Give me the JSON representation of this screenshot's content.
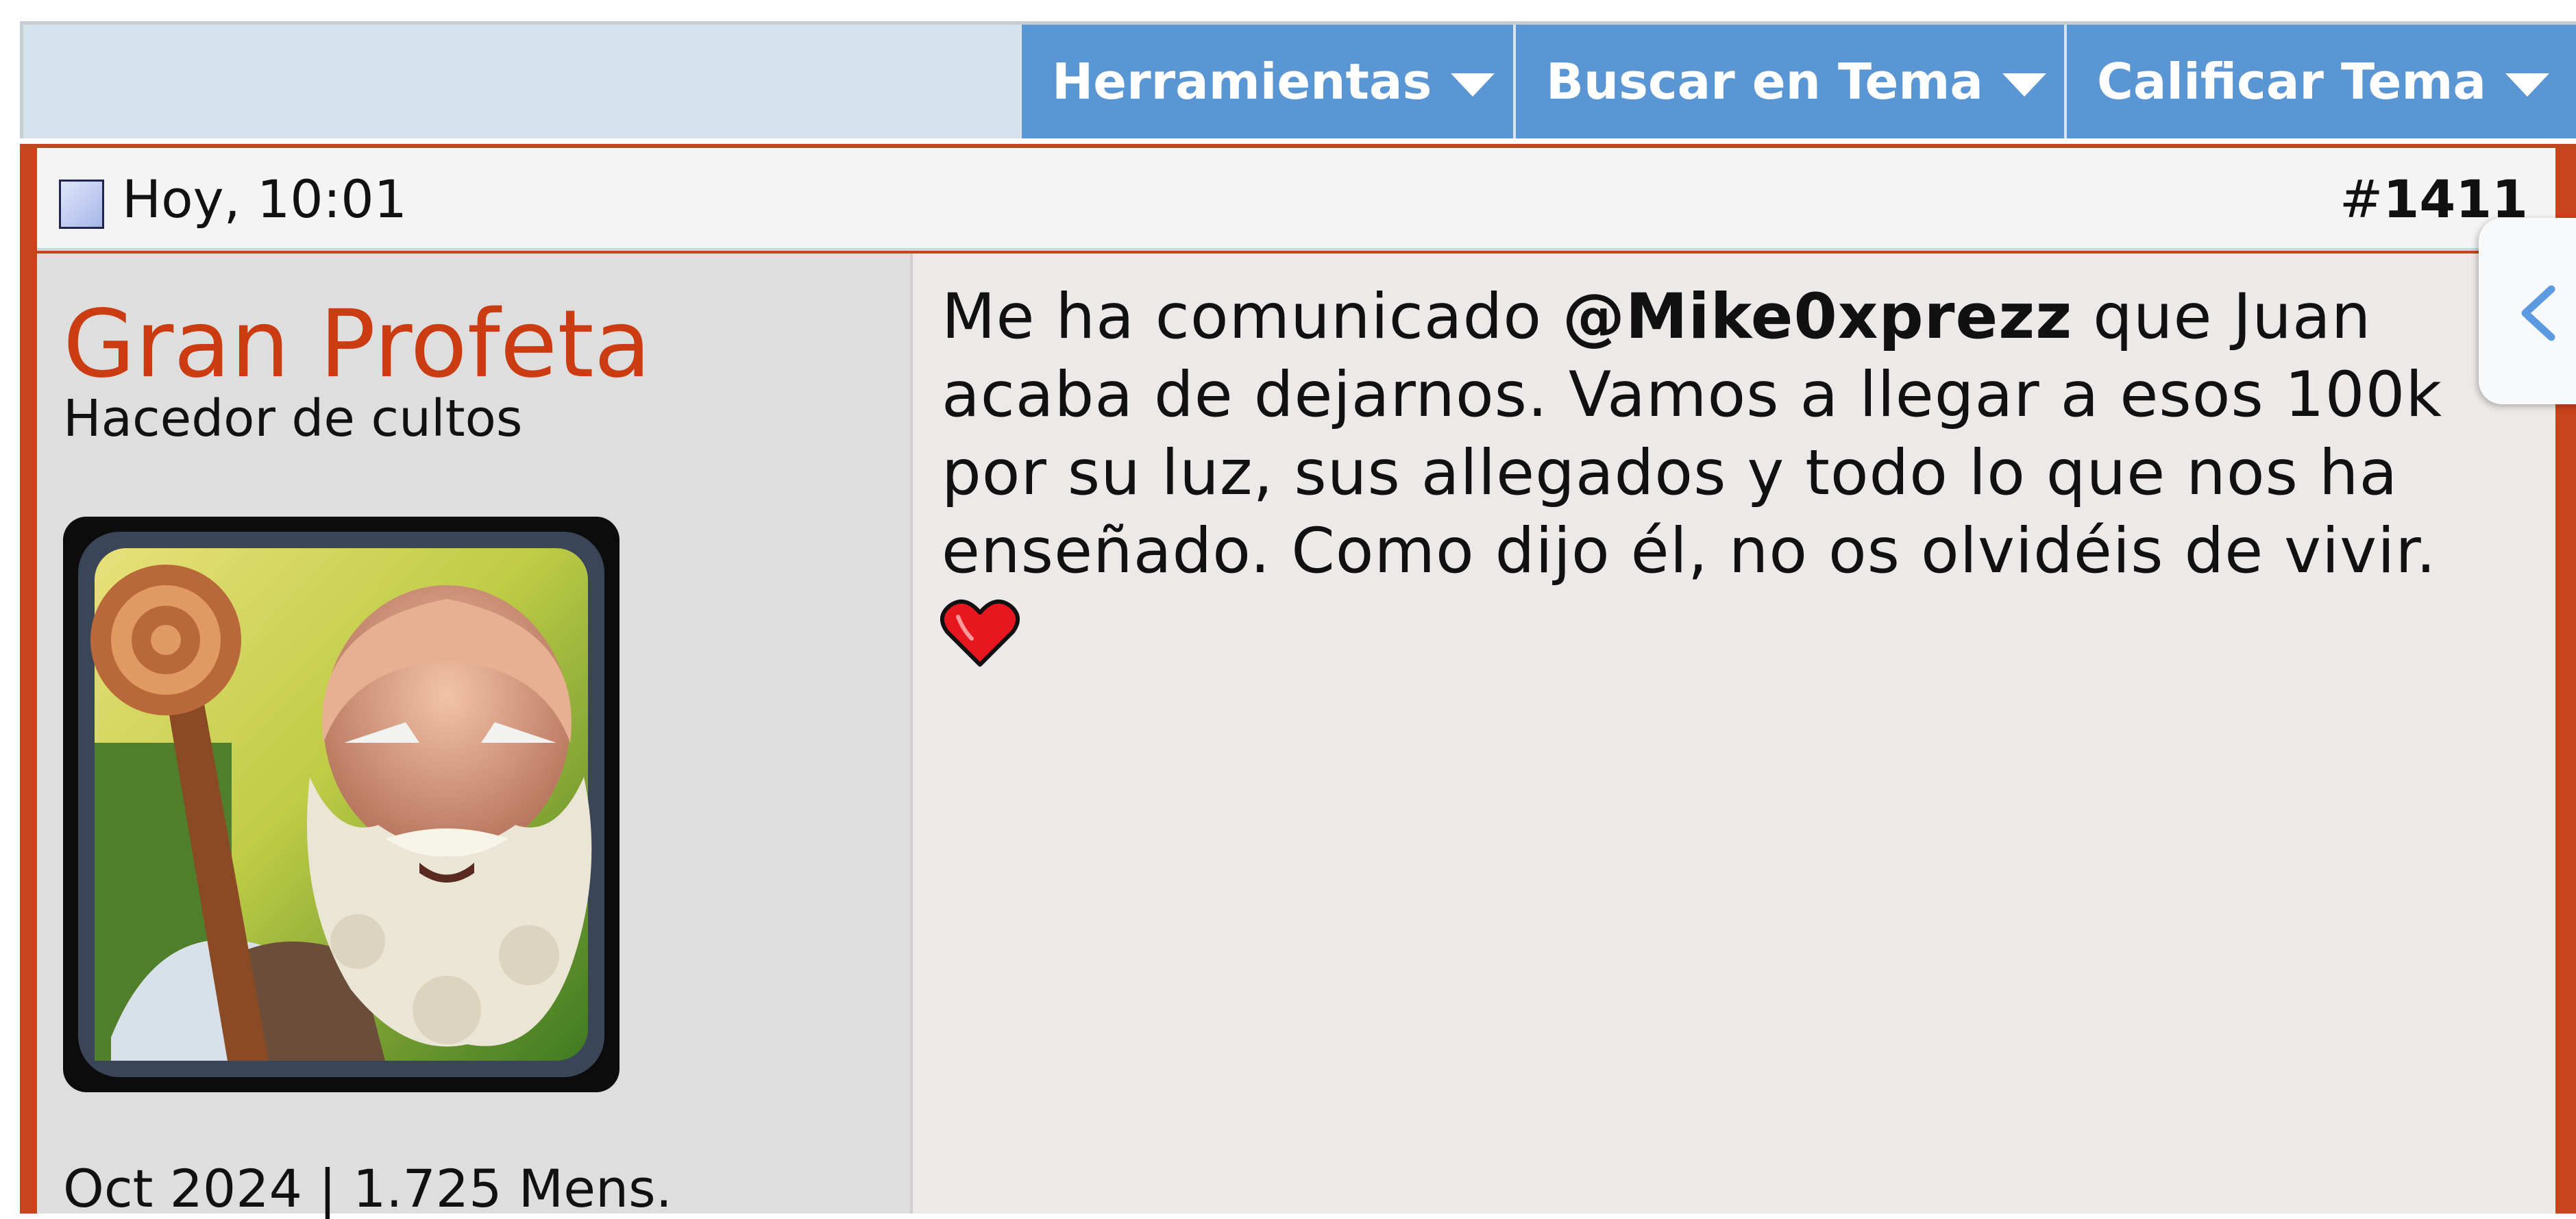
{
  "toolbar": {
    "tools_label": "Herramientas",
    "search_thread_label": "Buscar en Tema",
    "rate_thread_label": "Calificar Tema"
  },
  "post": {
    "date": "Hoy, 10:01",
    "number_prefix": "#",
    "number": "1411",
    "user": {
      "name": "Gran Profeta",
      "title": "Hacedor de cultos",
      "join_date": "Oct 2024",
      "separator": "|",
      "post_count": "1.725 Mens."
    },
    "message": {
      "text_before": "Me ha comunicado ",
      "mention": "@Mike0xprezz",
      "text_after": " que Juan acaba de dejarnos. Vamos a llegar a esos 100k por su luz, sus allegados y todo lo que nos ha enseñado. Como dijo él, no os olvidéis de vivir."
    }
  },
  "icons": {
    "post_status": "post-status-icon",
    "heart": "heart-icon",
    "side_panel": "chevron-left-icon",
    "dropdown": "caret-down-icon"
  },
  "colors": {
    "toolbar_button": "#5b96d4",
    "username": "#cb3c12",
    "post_border": "#c9431c",
    "side_arrow": "#5b9ae0",
    "heart": "#e8161f"
  }
}
